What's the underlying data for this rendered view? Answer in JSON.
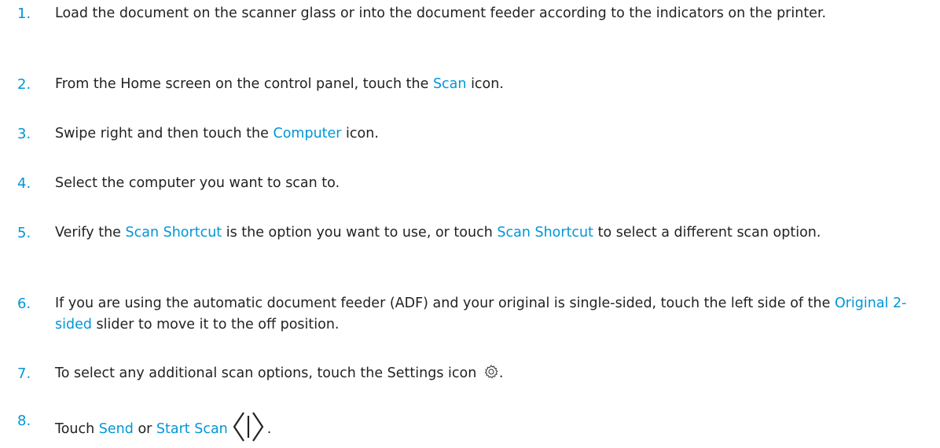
{
  "steps": [
    {
      "number": "1.",
      "text": "Load the document on the scanner glass or into the document feeder according to the indicators on the printer."
    },
    {
      "number": "2.",
      "pre": "From the Home screen on the control panel, touch the ",
      "link": "Scan",
      "post": " icon."
    },
    {
      "number": "3.",
      "pre": "Swipe right and then touch the ",
      "link": "Computer",
      "post": " icon."
    },
    {
      "number": "4.",
      "text": "Select the computer you want to scan to."
    },
    {
      "number": "5.",
      "pre": "Verify the ",
      "link1": "Scan Shortcut",
      "mid": " is the option you want to use, or touch ",
      "link2": "Scan Shortcut",
      "post": " to select a different scan option."
    },
    {
      "number": "6.",
      "pre": "If you are using the automatic document feeder (ADF) and your original is single-sided, touch the left side of the ",
      "link": "Original 2-sided",
      "post": " slider to move it to the off position."
    },
    {
      "number": "7.",
      "pre": "To select any additional scan options, touch the Settings icon ",
      "icon": "settings-gear-icon",
      "post": "."
    },
    {
      "number": "8.",
      "pre": "Touch ",
      "link1": "Send",
      "mid": " or ",
      "link2": "Start Scan",
      "icon": "start-diamond-icon",
      "post": "."
    }
  ],
  "colors": {
    "accent": "#0096d6",
    "text": "#222222",
    "background": "#ffffff"
  }
}
